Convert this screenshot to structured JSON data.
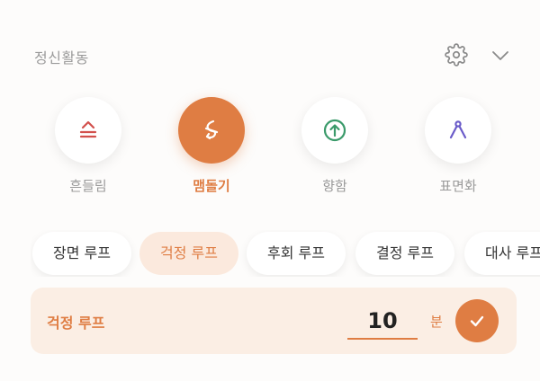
{
  "header": {
    "title": "정신활동"
  },
  "modes": [
    {
      "label": "흔들림",
      "icon": "wave-stack-icon"
    },
    {
      "label": "맴돌기",
      "icon": "spiral-icon",
      "active": true
    },
    {
      "label": "향함",
      "icon": "arrow-up-circle-icon"
    },
    {
      "label": "표면화",
      "icon": "compass-icon"
    }
  ],
  "chips": [
    {
      "label": "장면 루프"
    },
    {
      "label": "걱정 루프",
      "active": true
    },
    {
      "label": "후회 루프"
    },
    {
      "label": "결정 루프"
    },
    {
      "label": "대사 루프"
    }
  ],
  "panel": {
    "label": "걱정 루프",
    "value": "10",
    "unit": "분"
  },
  "colors": {
    "accent": "#df7d43",
    "accent_soft": "#fbeee4",
    "muted": "#9a9a9a"
  }
}
